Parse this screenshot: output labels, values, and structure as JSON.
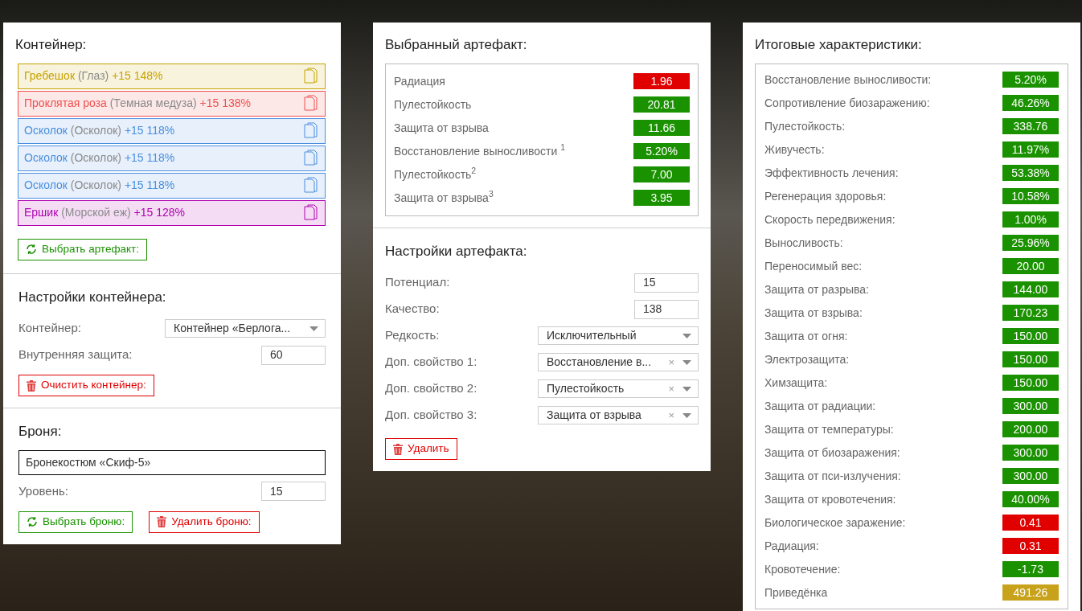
{
  "container": {
    "title": "Контейнер:",
    "artifacts": [
      {
        "name": "Гребешок",
        "type": "(Глаз)",
        "stats": "+15 148%",
        "color": "#c8a200"
      },
      {
        "name": "Проклятая роза",
        "type": "(Темная медуза)",
        "stats": "+15 138%",
        "color": "#f05050"
      },
      {
        "name": "Осколок",
        "type": "(Осколок)",
        "stats": "+15 118%",
        "color": "#4a8fe0"
      },
      {
        "name": "Осколок",
        "type": "(Осколок)",
        "stats": "+15 118%",
        "color": "#4a8fe0"
      },
      {
        "name": "Осколок",
        "type": "(Осколок)",
        "stats": "+15 118%",
        "color": "#4a8fe0"
      },
      {
        "name": "Ершик",
        "type": "(Морской еж)",
        "stats": "+15 128%",
        "color": "#b000b0"
      }
    ],
    "button": "Выбрать артефакт:"
  },
  "container_settings": {
    "title": "Настройки контейнера:",
    "fields": [
      {
        "kind": "select",
        "label": "Контейнер:",
        "value": "Контейнер «Берлога..."
      },
      {
        "kind": "input",
        "label": "Внутренняя защита:",
        "value": "60"
      }
    ],
    "button": "Очистить контейнер:"
  },
  "armor": {
    "title": "Броня:",
    "value": "Бронекостюм «Скиф-5»",
    "fields": [
      {
        "kind": "input",
        "label": "Уровень:",
        "value": "15"
      }
    ],
    "buttons": [
      {
        "kind": "select",
        "label": "Выбрать броню:"
      },
      {
        "kind": "delete",
        "label": "Удалить броню:"
      }
    ]
  },
  "selected_artifact": {
    "title": "Выбранный артефакт:",
    "stats": [
      {
        "label": "Радиация",
        "value": "1.96",
        "kind": "negative"
      },
      {
        "label": "Пулестойкость",
        "value": "20.81",
        "kind": "positive"
      },
      {
        "label": "Защита от взрыва",
        "value": "11.66",
        "kind": "positive"
      },
      {
        "label": "Восстановление выносливости $^{1}$",
        "value": "5.20%",
        "kind": "positive"
      },
      {
        "label": "Пулестойкость$^{2}$",
        "value": "7.00",
        "kind": "positive"
      },
      {
        "label": "Защита от взрыва$^{3}$",
        "value": "3.95",
        "kind": "positive"
      }
    ]
  },
  "artifact_settings": {
    "title": "Настройки артефакта:",
    "fields": [
      {
        "kind": "input",
        "label": "Потенциал:",
        "value": "15"
      },
      {
        "kind": "input",
        "label": "Качество:",
        "value": "138"
      },
      {
        "kind": "select",
        "label": "Редкость:",
        "value": "Исключительный"
      },
      {
        "kind": "select",
        "label": "Доп. свойство 1:",
        "value": "Восстановление в...",
        "clear_icon": "×"
      },
      {
        "kind": "select",
        "label": "Доп. свойство 2:",
        "value": "Пулестойкость",
        "clear_icon": "×"
      },
      {
        "kind": "select",
        "label": "Доп. свойство 3:",
        "value": "Защита от взрыва",
        "clear_icon": "×"
      }
    ],
    "button": "Удалить"
  },
  "totals": {
    "title": "Итоговые характеристики:",
    "stats": [
      {
        "label": "Восстановление выносливости:",
        "value": "5.20%",
        "kind": "positive"
      },
      {
        "label": "Сопротивление биозаражению:",
        "value": "46.26%",
        "kind": "positive"
      },
      {
        "label": "Пулестойкость:",
        "value": "338.76",
        "kind": "positive"
      },
      {
        "label": "Живучесть:",
        "value": "11.97%",
        "kind": "positive"
      },
      {
        "label": "Эффективность лечения:",
        "value": "53.38%",
        "kind": "positive"
      },
      {
        "label": "Регенерация здоровья:",
        "value": "10.58%",
        "kind": "positive"
      },
      {
        "label": "Скорость передвижения:",
        "value": "1.00%",
        "kind": "positive"
      },
      {
        "label": "Выносливость:",
        "value": "25.96%",
        "kind": "positive"
      },
      {
        "label": "Переносимый вес:",
        "value": "20.00",
        "kind": "positive"
      },
      {
        "label": "Защита от разрыва:",
        "value": "144.00",
        "kind": "positive"
      },
      {
        "label": "Защита от взрыва:",
        "value": "170.23",
        "kind": "positive"
      },
      {
        "label": "Защита от огня:",
        "value": "150.00",
        "kind": "positive"
      },
      {
        "label": "Электрозащита:",
        "value": "150.00",
        "kind": "positive"
      },
      {
        "label": "Химзащита:",
        "value": "150.00",
        "kind": "positive"
      },
      {
        "label": "Защита от радиации:",
        "value": "300.00",
        "kind": "positive"
      },
      {
        "label": "Защита от температуры:",
        "value": "200.00",
        "kind": "positive"
      },
      {
        "label": "Защита от биозаражения:",
        "value": "300.00",
        "kind": "positive"
      },
      {
        "label": "Защита от пси-излучения:",
        "value": "300.00",
        "kind": "positive"
      },
      {
        "label": "Защита от кровотечения:",
        "value": "40.00%",
        "kind": "positive"
      },
      {
        "label": "Биологическое заражение:",
        "value": "0.41",
        "kind": "negative"
      },
      {
        "label": "Радиация:",
        "value": "0.31",
        "kind": "negative"
      },
      {
        "label": "Кровотечение:",
        "value": "-1.73",
        "kind": "positive"
      },
      {
        "label": "Приведёнка",
        "value": "491.26",
        "kind": "neutral"
      }
    ]
  }
}
